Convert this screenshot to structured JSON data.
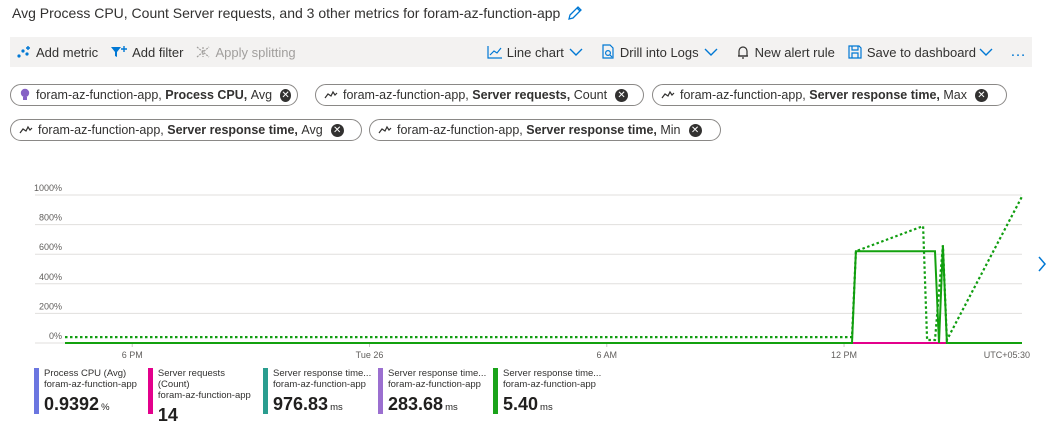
{
  "title": "Avg Process CPU, Count Server requests, and 3 other metrics for foram-az-function-app",
  "toolbar": {
    "add_metric": "Add metric",
    "add_filter": "Add filter",
    "apply_splitting": "Apply splitting",
    "line_chart": "Line chart",
    "drill_logs": "Drill into Logs",
    "new_alert": "New alert rule",
    "save_dashboard": "Save to dashboard",
    "more": "…"
  },
  "chips": [
    {
      "resource": "foram-az-function-app,",
      "metric": "Process CPU,",
      "agg": "Avg",
      "icon": "bulb-icon"
    },
    {
      "resource": "foram-az-function-app,",
      "metric": "Server requests,",
      "agg": "Count",
      "icon": "line-icon"
    },
    {
      "resource": "foram-az-function-app,",
      "metric": "Server response time,",
      "agg": "Max",
      "icon": "line-icon"
    },
    {
      "resource": "foram-az-function-app,",
      "metric": "Server response time,",
      "agg": "Avg",
      "icon": "line-icon"
    },
    {
      "resource": "foram-az-function-app,",
      "metric": "Server response time,",
      "agg": "Min",
      "icon": "line-icon"
    }
  ],
  "chart_data": {
    "type": "line",
    "ylim": [
      0,
      1000
    ],
    "y_ticks": [
      "0%",
      "200%",
      "400%",
      "600%",
      "800%",
      "1000%"
    ],
    "y_tick_values": [
      0,
      200,
      400,
      600,
      800,
      1000
    ],
    "x_ticks": [
      "6 PM",
      "Tue 26",
      "6 AM",
      "12 PM"
    ],
    "x_tick_values": [
      18,
      24,
      30,
      36
    ],
    "x_range": [
      16.3,
      40.5
    ],
    "timezone": "UTC+05:30",
    "grid": true,
    "series": [
      {
        "name": "Process CPU (Avg)",
        "color": "#0f9d0f",
        "style": "dashed",
        "x": [
          16.3,
          36.2,
          36.3,
          38.0,
          38.1,
          38.3,
          38.5,
          38.6,
          40.5
        ],
        "y": [
          40,
          40,
          620,
          790,
          20,
          20,
          660,
          20,
          990
        ]
      },
      {
        "name": "Server requests (Count)",
        "color": "#e3008c",
        "style": "solid",
        "x": [
          16.3,
          40.5
        ],
        "y": [
          0,
          0
        ]
      },
      {
        "name": "Server response time (Min)",
        "color": "#13a10e",
        "style": "solid",
        "x": [
          16.3,
          36.2,
          36.3,
          38.3,
          38.4,
          38.5,
          38.6,
          40.5
        ],
        "y": [
          0,
          0,
          620,
          620,
          0,
          660,
          0,
          0
        ]
      }
    ]
  },
  "legend": [
    {
      "name": "Process CPU (Avg)",
      "resource": "foram-az-function-app",
      "value": "0.9392",
      "unit": "%",
      "color": "#6b76e0"
    },
    {
      "name": "Server requests (Count)",
      "resource": "foram-az-function-app",
      "value": "14",
      "unit": "",
      "color": "#e3008c"
    },
    {
      "name": "Server response time...",
      "resource": "foram-az-function-app",
      "value": "976.83",
      "unit": "ms",
      "color": "#2a9d8f"
    },
    {
      "name": "Server response time...",
      "resource": "foram-az-function-app",
      "value": "283.68",
      "unit": "ms",
      "color": "#9b6fd0"
    },
    {
      "name": "Server response time...",
      "resource": "foram-az-function-app",
      "value": "5.40",
      "unit": "ms",
      "color": "#1aa31a"
    }
  ]
}
